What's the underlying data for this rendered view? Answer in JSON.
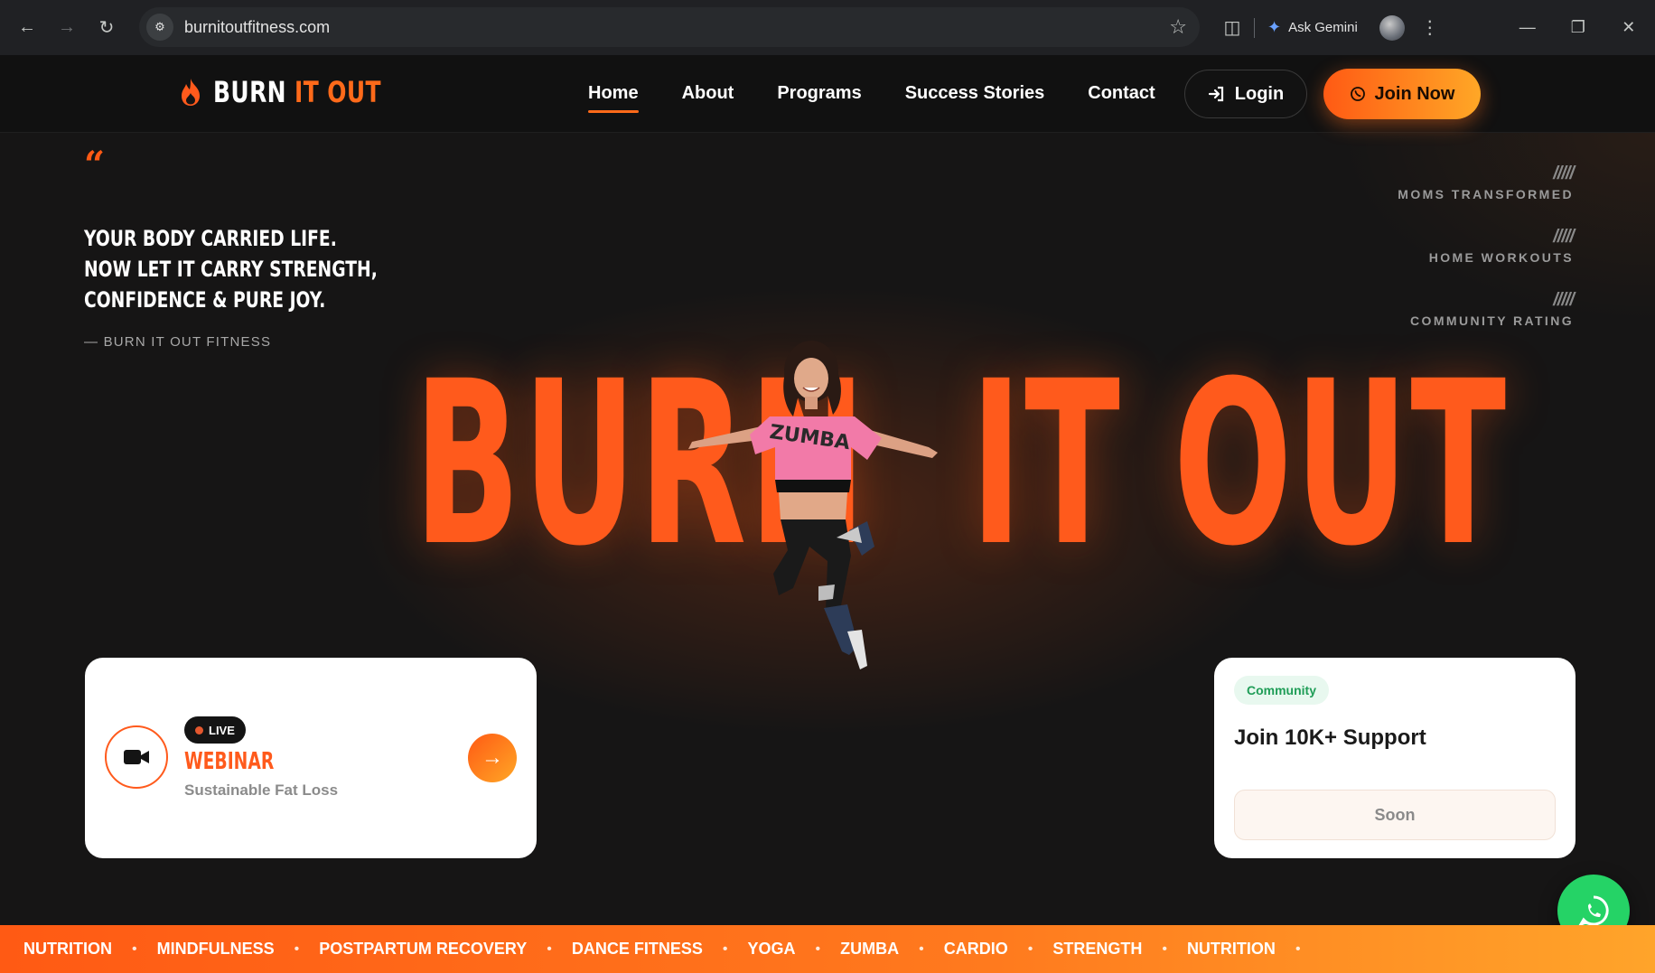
{
  "browser": {
    "url": "burnitoutfitness.com",
    "gemini_label": "Ask Gemini"
  },
  "header": {
    "brand_part1": "BURN",
    "brand_part2": "IT OUT",
    "nav": [
      {
        "label": "Home",
        "active": true
      },
      {
        "label": "About"
      },
      {
        "label": "Programs"
      },
      {
        "label": "Success Stories"
      },
      {
        "label": "Contact"
      }
    ],
    "login_label": "Login",
    "join_label": "Join Now"
  },
  "hero": {
    "quote_mark": "“",
    "quote_lines": [
      "YOUR BODY CARRIED LIFE.",
      "NOW LET IT CARRY STRENGTH,",
      "CONFIDENCE & PURE JOY."
    ],
    "quote_source": "— BURN IT OUT FITNESS",
    "title_left": "BURN",
    "title_right": "IT OUT",
    "stats": [
      {
        "value": "/////",
        "label": "MOMS TRANSFORMED"
      },
      {
        "value": "/////",
        "label": "HOME WORKOUTS"
      },
      {
        "value": "/////",
        "label": "COMMUNITY RATING"
      }
    ]
  },
  "webinar_card": {
    "badge": "LIVE",
    "title": "WEBINAR",
    "subtitle": "Sustainable Fat Loss"
  },
  "community_card": {
    "badge": "Community",
    "title": "Join 10K+ Support",
    "button": "Soon"
  },
  "ticker": [
    "NUTRITION",
    "MINDFULNESS",
    "POSTPARTUM RECOVERY",
    "DANCE FITNESS",
    "YOGA",
    "ZUMBA",
    "CARDIO",
    "STRENGTH",
    "NUTRITION"
  ],
  "colors": {
    "accent": "#ff5a1c",
    "whatsapp": "#25d366"
  }
}
